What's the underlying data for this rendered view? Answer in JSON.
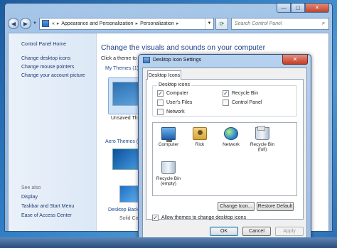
{
  "window": {
    "breadcrumb": [
      "Appearance and Personalization",
      "Personalization"
    ],
    "breadcrumb_prefix": "«",
    "search_placeholder": "Search Control Panel",
    "buttons": {
      "minimize": "—",
      "maximize": "▢",
      "close": "✕"
    }
  },
  "left_pane": {
    "home": "Control Panel Home",
    "links": [
      "Change desktop icons",
      "Change mouse pointers",
      "Change your account picture"
    ],
    "see_also_title": "See also",
    "see_also": [
      "Display",
      "Taskbar and Start Menu",
      "Ease of Access Center"
    ]
  },
  "main": {
    "heading": "Change the visuals and sounds on your computer",
    "subtext": "Click a theme to",
    "my_themes": "My Themes (1)",
    "unsaved_theme": "Unsaved Th",
    "aero_themes": "Aero Themes (6",
    "desktop_background": "Desktop Backgr",
    "solid_color": "Solid Colo"
  },
  "dialog": {
    "title": "Desktop Icon Settings",
    "close_label": "✕",
    "tab": "Desktop Icons",
    "group_label": "Desktop icons",
    "checkboxes": {
      "computer": {
        "label": "Computer",
        "checked": "✓"
      },
      "users_files": {
        "label": "User's Files",
        "checked": ""
      },
      "network": {
        "label": "Network",
        "checked": ""
      },
      "recycle_bin": {
        "label": "Recycle Bin",
        "checked": "✓"
      },
      "control_panel": {
        "label": "Control Panel",
        "checked": ""
      }
    },
    "icons": [
      {
        "label": "Computer",
        "icon": "computer-icon"
      },
      {
        "label": "Rick",
        "icon": "user-folder-icon"
      },
      {
        "label": "Network",
        "icon": "network-icon"
      },
      {
        "label": "Recycle Bin (full)",
        "icon": "recycle-bin-full-icon"
      },
      {
        "label": "Recycle Bin (empty)",
        "icon": "recycle-bin-empty-icon"
      }
    ],
    "change_icon": "Change Icon...",
    "restore_default": "Restore Default",
    "allow_themes": {
      "label": "Allow themes to change desktop icons",
      "checked": "✓"
    },
    "ok": "OK",
    "cancel": "Cancel",
    "apply": "Apply"
  }
}
